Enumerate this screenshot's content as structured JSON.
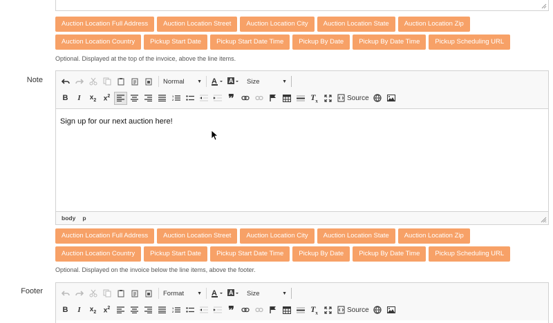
{
  "tags": [
    "Auction Location Full Address",
    "Auction Location Street",
    "Auction Location City",
    "Auction Location State",
    "Auction Location Zip",
    "Auction Location Country",
    "Pickup Start Date",
    "Pickup Start Date Time",
    "Pickup By Date",
    "Pickup By Date Time",
    "Pickup Scheduling URL"
  ],
  "header_section": {
    "help": "Optional. Displayed at the top of the invoice, above the line items."
  },
  "note_section": {
    "label": "Note",
    "format_combo": "Normal",
    "size_combo": "Size",
    "source_label": "Source",
    "content": "Sign up for our next auction here!",
    "path": [
      "body",
      "p"
    ],
    "help": "Optional. Displayed on the invoice below the line items, above the footer."
  },
  "footer_section": {
    "label": "Footer",
    "format_combo": "Format",
    "size_combo": "Size",
    "source_label": "Source"
  },
  "colors": {
    "tag_bg": "#f7a167",
    "border": "#d1d1d1",
    "toolbar_bg": "#f8f8f8"
  }
}
